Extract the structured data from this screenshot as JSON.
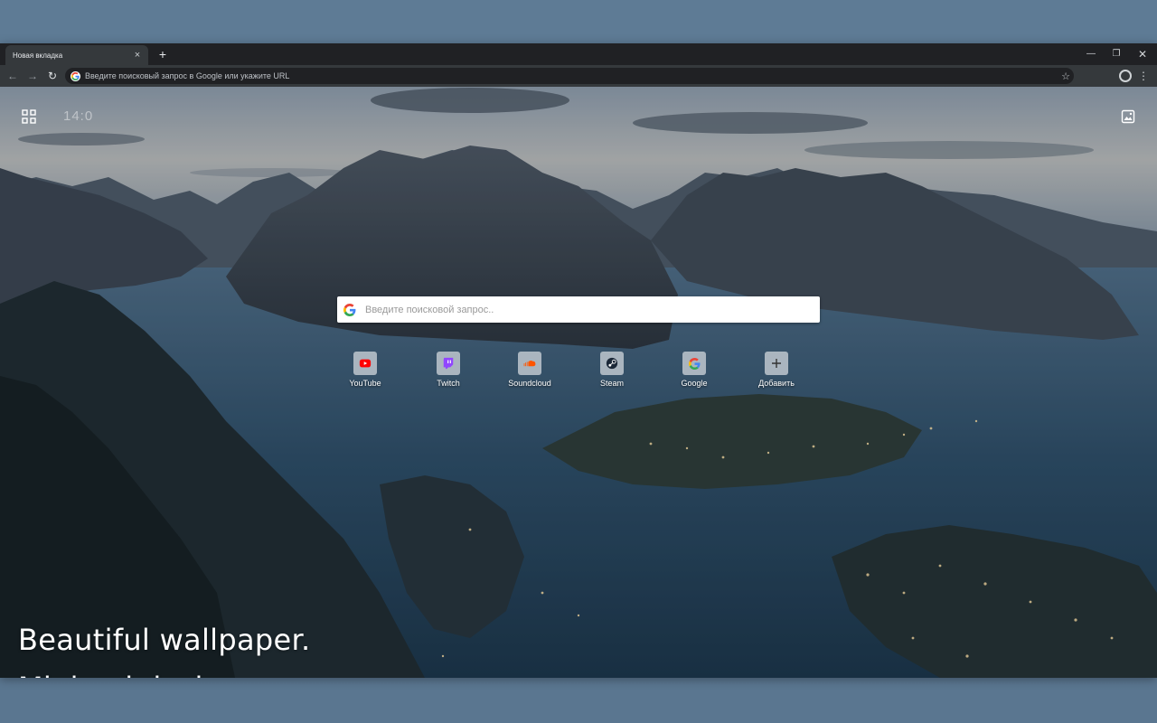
{
  "browser": {
    "tab": {
      "title": "Новая вкладка",
      "close_glyph": "×"
    },
    "new_tab_glyph": "+",
    "window_controls": {
      "minimize": "—",
      "maximize": "❐",
      "close": "✕"
    },
    "toolbar": {
      "back_glyph": "←",
      "forward_glyph": "→",
      "reload_glyph": "↻",
      "omnibox_placeholder": "Введите поисковый запрос в Google или укажите URL",
      "star_glyph": "☆",
      "menu_glyph": "⋮"
    }
  },
  "newtab": {
    "clock": "14:0",
    "search": {
      "placeholder": "Введите поисковой запрос.."
    },
    "shortcuts": [
      {
        "label": "YouTube",
        "icon": "youtube-icon",
        "color": "#ff0000"
      },
      {
        "label": "Twitch",
        "icon": "twitch-icon",
        "color": "#9146ff"
      },
      {
        "label": "Soundcloud",
        "icon": "soundcloud-icon",
        "color": "#ff5500"
      },
      {
        "label": "Steam",
        "icon": "steam-icon",
        "color": "#1b2838"
      },
      {
        "label": "Google",
        "icon": "google-icon",
        "color": "#4285f4"
      },
      {
        "label": "Добавить",
        "icon": "plus-icon",
        "color": "#333333"
      }
    ],
    "tagline": {
      "line1": "Beautiful wallpaper.",
      "line2": "Minimal design"
    }
  },
  "colors": {
    "titlebar": "#202124",
    "toolbar": "#35393c",
    "frame_background": "#5d7a94"
  }
}
